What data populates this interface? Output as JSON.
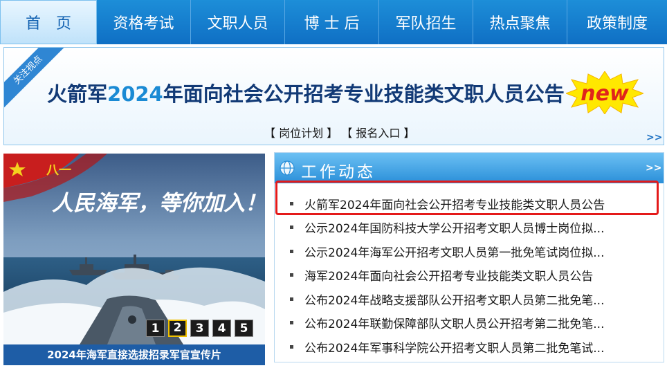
{
  "nav": {
    "items": [
      {
        "label": "首　页",
        "active": true
      },
      {
        "label": "资格考试",
        "active": false
      },
      {
        "label": "文职人员",
        "active": false
      },
      {
        "label": "博 士 后",
        "active": false
      },
      {
        "label": "军队招生",
        "active": false
      },
      {
        "label": "热点聚焦",
        "active": false
      },
      {
        "label": "政策制度",
        "active": false
      }
    ]
  },
  "focus": {
    "ribbon": "关注视点",
    "headline_prefix": "火箭军",
    "headline_year": "2024",
    "headline_suffix": "年面向社会公开招考专业技能类文职人员公告",
    "new_badge": "new",
    "link_plan": "【 岗位计划 】",
    "link_signup": "【 报名入口 】",
    "more": ">>"
  },
  "promo": {
    "slogan": "人民海军，等你加入！",
    "flag_text": "八一",
    "slides": [
      "1",
      "2",
      "3",
      "4",
      "5"
    ],
    "active_slide": 2,
    "caption": "2024年海军直接选拔招录军官宣传片"
  },
  "news": {
    "title": "工作动态",
    "more": ">>",
    "items": [
      "火箭军2024年面向社会公开招考专业技能类文职人员公告",
      "公示2024年国防科技大学公开招考文职人员博士岗位拟...",
      "公示2024年海军公开招考文职人员第一批免笔试岗位拟...",
      "海军2024年面向社会公开招考专业技能类文职人员公告",
      "公布2024年战略支援部队公开招考文职人员第二批免笔...",
      "公布2024年联勤保障部队文职人员公开招考第二批免笔...",
      "公布2024年军事科学院公开招考文职人员第二批免笔试..."
    ],
    "highlight_color": "#e41a1a"
  },
  "colors": {
    "nav_bg": "#0f6fc4",
    "headline": "#123a76",
    "year": "#1a8ad4",
    "caption_bg": "#1e5da6"
  }
}
